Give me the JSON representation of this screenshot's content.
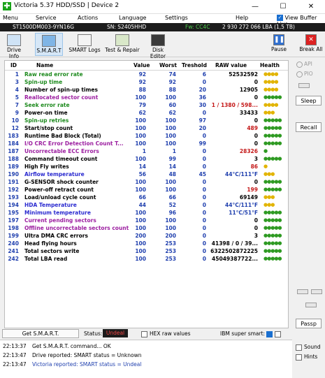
{
  "window": {
    "title": "Victoria 5.37 HDD/SSD | Device 2",
    "icon_glyph": "✚",
    "minimize": "—",
    "maximize": "☐",
    "close": "✕"
  },
  "menu": {
    "items": [
      "Menu",
      "Service",
      "Actions",
      "Language",
      "Settings",
      "Help"
    ],
    "view_buffer_label": "View Buffer Live"
  },
  "drive": {
    "model": "ST1500DM003-9YN16G",
    "serial": "SN: S2405HHD",
    "fw": "Fw: CC4C",
    "capacity": "2 930 272 066 LBA (1,5 TB)"
  },
  "toolbar": {
    "drive_info": "Drive Info",
    "smart": "S.M.A.R.T",
    "smart_logs": "SMART Logs",
    "test_repair": "Test & Repair",
    "disk_editor": "Disk Editor",
    "pause": "Pause",
    "break_all": "Break All"
  },
  "table": {
    "headers": {
      "id": "ID",
      "name": "Name",
      "value": "Value",
      "worst": "Worst",
      "treshold": "Treshold",
      "raw": "RAW value",
      "health": "Health"
    },
    "rows": [
      {
        "id": "1",
        "name": "Raw read error rate",
        "value": "92",
        "worst": "74",
        "tr": "6",
        "raw": "52532592",
        "health": "●●●●",
        "nc": "cg",
        "rc": "",
        "hc": "hy"
      },
      {
        "id": "3",
        "name": "Spin-up time",
        "value": "92",
        "worst": "92",
        "tr": "0",
        "raw": "0",
        "health": "●●●●",
        "nc": "cg",
        "rc": "",
        "hc": "hy"
      },
      {
        "id": "4",
        "name": "Number of spin-up times",
        "value": "88",
        "worst": "88",
        "tr": "20",
        "raw": "12905",
        "health": "●●●●",
        "nc": "",
        "rc": "",
        "hc": "hy"
      },
      {
        "id": "5",
        "name": "Reallocated sector count",
        "value": "100",
        "worst": "100",
        "tr": "36",
        "raw": "0",
        "health": "●●●●●",
        "nc": "cm",
        "rc": "",
        "hc": ""
      },
      {
        "id": "7",
        "name": "Seek error rate",
        "value": "79",
        "worst": "60",
        "tr": "30",
        "raw": "1 / 1380 / 598...",
        "health": "●●●●",
        "nc": "cg",
        "rc": "rr",
        "hc": "hy"
      },
      {
        "id": "9",
        "name": "Power-on time",
        "value": "62",
        "worst": "62",
        "tr": "0",
        "raw": "33433",
        "health": "●●●",
        "nc": "",
        "rc": "",
        "hc": "hy"
      },
      {
        "id": "10",
        "name": "Spin-up retries",
        "value": "100",
        "worst": "100",
        "tr": "97",
        "raw": "0",
        "health": "●●●●●",
        "nc": "cg",
        "rc": "",
        "hc": ""
      },
      {
        "id": "12",
        "name": "Start/stop count",
        "value": "100",
        "worst": "100",
        "tr": "20",
        "raw": "489",
        "health": "●●●●●",
        "nc": "",
        "rc": "rr",
        "hc": ""
      },
      {
        "id": "183",
        "name": "Runtime Bad Block (Total)",
        "value": "100",
        "worst": "100",
        "tr": "0",
        "raw": "0",
        "health": "●●●●●",
        "nc": "",
        "rc": "",
        "hc": ""
      },
      {
        "id": "184",
        "name": "I/O CRC Error Detection Count T...",
        "value": "100",
        "worst": "100",
        "tr": "99",
        "raw": "0",
        "health": "●●●●●",
        "nc": "cm",
        "rc": "",
        "hc": ""
      },
      {
        "id": "187",
        "name": "Uncorrectable ECC Errors",
        "value": "1",
        "worst": "1",
        "tr": "0",
        "raw": "28326",
        "health": "●",
        "nc": "cm",
        "rc": "rr",
        "hc": "rr"
      },
      {
        "id": "188",
        "name": "Command timeout count",
        "value": "100",
        "worst": "99",
        "tr": "0",
        "raw": "3",
        "health": "●●●●●",
        "nc": "",
        "rc": "",
        "hc": ""
      },
      {
        "id": "189",
        "name": "High Fly writes",
        "value": "14",
        "worst": "14",
        "tr": "0",
        "raw": "86",
        "health": "●",
        "nc": "",
        "rc": "rr",
        "hc": "hy"
      },
      {
        "id": "190",
        "name": "Airflow temperature",
        "value": "56",
        "worst": "48",
        "tr": "45",
        "raw": "44°C/111°F",
        "health": "●●●",
        "nc": "cn",
        "rc": "rb",
        "hc": "hy"
      },
      {
        "id": "191",
        "name": "G-SENSOR shock counter",
        "value": "100",
        "worst": "100",
        "tr": "0",
        "raw": "0",
        "health": "●●●●●",
        "nc": "",
        "rc": "",
        "hc": ""
      },
      {
        "id": "192",
        "name": "Power-off retract count",
        "value": "100",
        "worst": "100",
        "tr": "0",
        "raw": "199",
        "health": "●●●●●",
        "nc": "",
        "rc": "rr",
        "hc": ""
      },
      {
        "id": "193",
        "name": "Load/unload cycle count",
        "value": "66",
        "worst": "66",
        "tr": "0",
        "raw": "69149",
        "health": "●●●",
        "nc": "",
        "rc": "",
        "hc": "hy"
      },
      {
        "id": "194",
        "name": "HDA Temperature",
        "value": "44",
        "worst": "52",
        "tr": "0",
        "raw": "44°C/111°F",
        "health": "●●●",
        "nc": "cn",
        "rc": "rb",
        "hc": "hy"
      },
      {
        "id": "195",
        "name": "Minimum temperature",
        "value": "100",
        "worst": "96",
        "tr": "0",
        "raw": "11°C/51°F",
        "health": "●●●●●",
        "nc": "cn",
        "rc": "rb",
        "hc": ""
      },
      {
        "id": "197",
        "name": "Current pending sectors",
        "value": "100",
        "worst": "100",
        "tr": "0",
        "raw": "0",
        "health": "●●●●●",
        "nc": "cm",
        "rc": "",
        "hc": ""
      },
      {
        "id": "198",
        "name": "Offline uncorrectable sectors count",
        "value": "100",
        "worst": "100",
        "tr": "0",
        "raw": "0",
        "health": "●●●●●",
        "nc": "cm",
        "rc": "",
        "hc": ""
      },
      {
        "id": "199",
        "name": "Ultra DMA CRC errors",
        "value": "200",
        "worst": "200",
        "tr": "0",
        "raw": "3",
        "health": "●●●●●",
        "nc": "",
        "rc": "",
        "hc": ""
      },
      {
        "id": "240",
        "name": "Head flying hours",
        "value": "100",
        "worst": "253",
        "tr": "0",
        "raw": "41398 / 0 / 39...",
        "health": "●●●●●",
        "nc": "",
        "rc": "",
        "hc": ""
      },
      {
        "id": "241",
        "name": "Total sectors write",
        "value": "100",
        "worst": "253",
        "tr": "0",
        "raw": "6322502872225",
        "health": "●●●●●",
        "nc": "",
        "rc": "",
        "hc": ""
      },
      {
        "id": "242",
        "name": "Total LBA read",
        "value": "100",
        "worst": "253",
        "tr": "0",
        "raw": "45049387722...",
        "health": "●●●●●",
        "nc": "",
        "rc": "",
        "hc": ""
      }
    ]
  },
  "side": {
    "api": "API",
    "pio": "PIO",
    "sleep": "Sleep",
    "recall": "Recall",
    "passp": "Passp"
  },
  "status": {
    "get_smart": "Get S.M.A.R.T.",
    "label": "Status:",
    "value": "Undeal",
    "hex": "HEX raw values",
    "ibm": "IBM super smart:"
  },
  "log": [
    {
      "time": "22:13:37",
      "text": "Get S.M.A.R.T. command... OK",
      "blue": false
    },
    {
      "time": "22:13:47",
      "text": "Drive reported: SMART status = Unknown",
      "blue": false
    },
    {
      "time": "22:13:47",
      "text": "Victoria reported: SMART status = Undeal",
      "blue": true
    }
  ],
  "bottom_right": {
    "sound": "Sound",
    "hints": "Hints"
  }
}
